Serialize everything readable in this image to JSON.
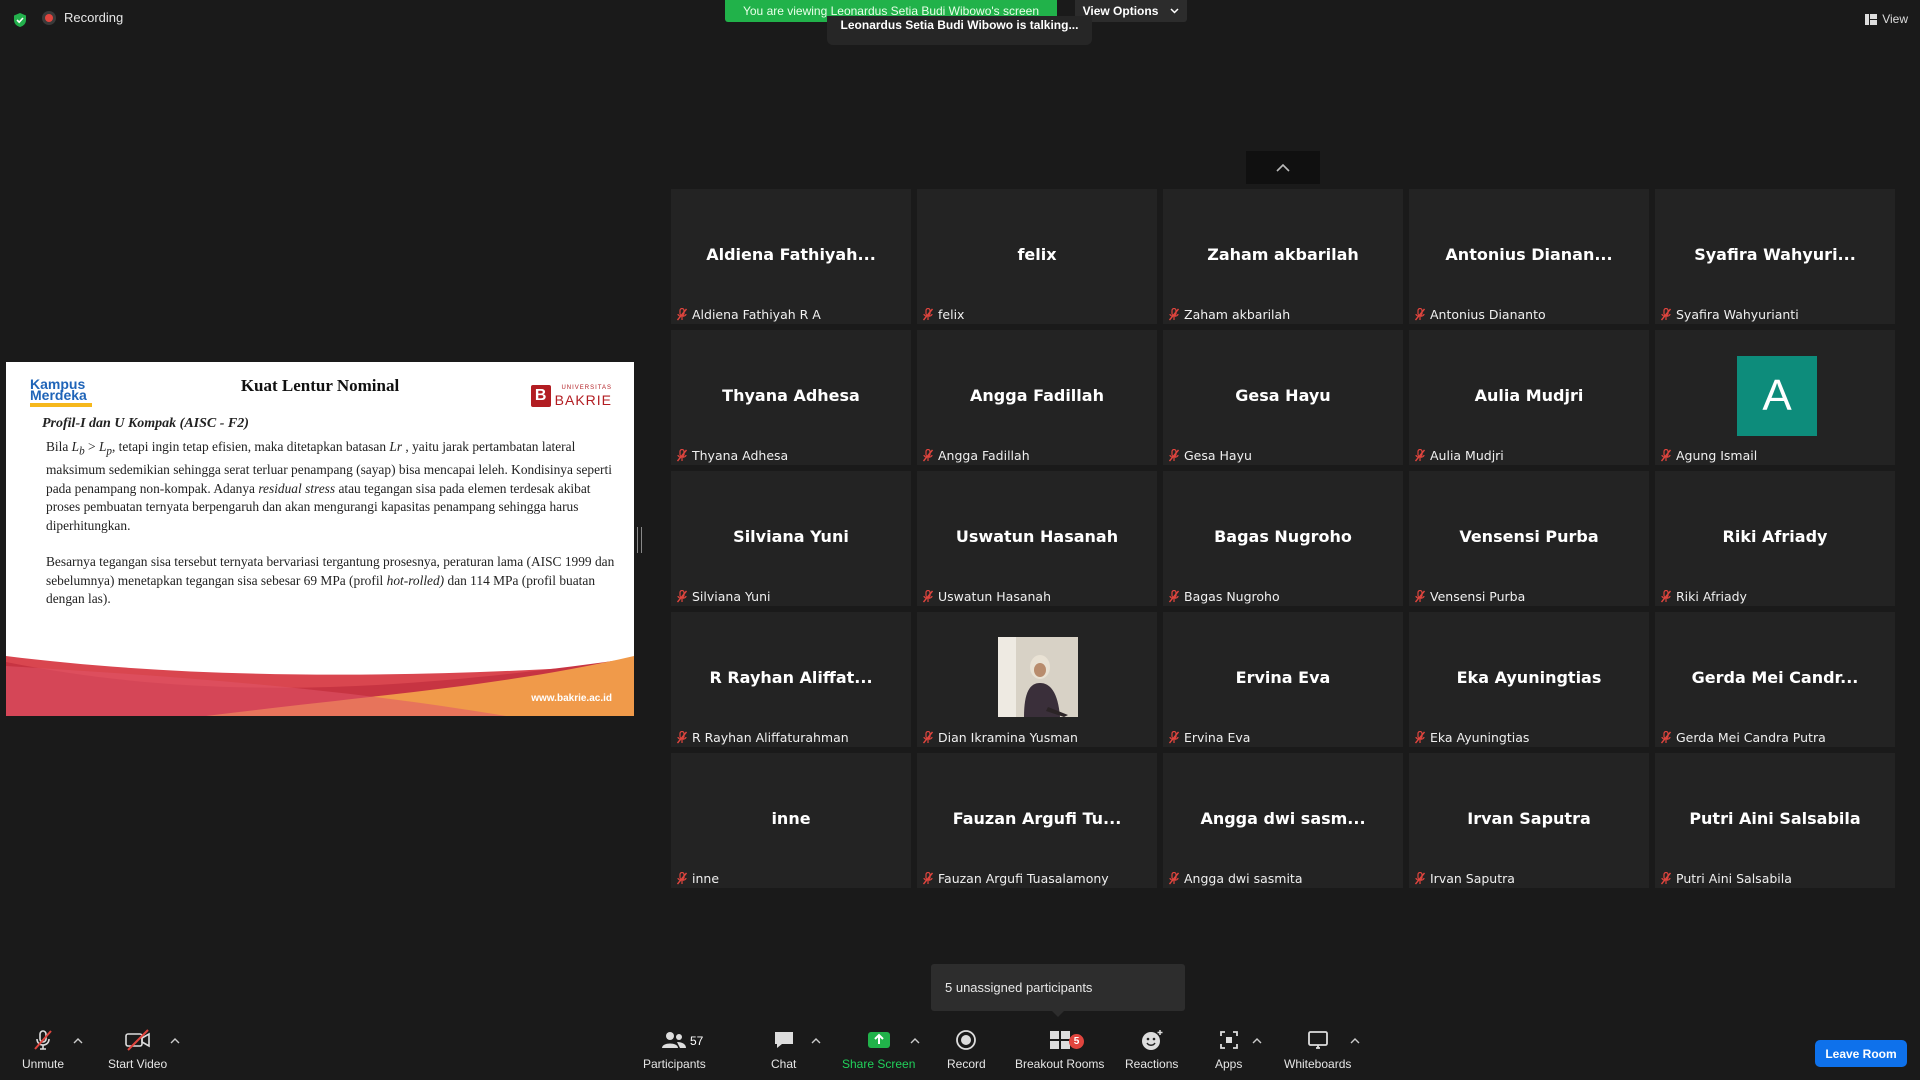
{
  "top": {
    "recording_label": "Recording",
    "viewing_banner": "You are viewing Leonardus Setia Budi Wibowo's screen",
    "view_options_label": "View Options",
    "talking_label": "Leonardus Setia Budi Wibowo is talking...",
    "view_label": "View"
  },
  "slide": {
    "title": "Kuat Lentur Nominal",
    "logo_left_line1": "Kampus",
    "logo_left_line2": "Merdeka",
    "logo_right_small": "UNIVERSITAS",
    "logo_right_name": "BAKRIE",
    "subtitle": "Profil-I dan U Kompak (AISC - F2)",
    "p1_a": "Bila ",
    "p1_lb": "L",
    "p1_lb_sub": "b",
    "p1_gt": " > ",
    "p1_lp": "L",
    "p1_lp_sub": "p",
    "p1_b": ", tetapi ingin tetap efisien, maka ditetapkan batasan ",
    "p1_lr": "Lr",
    "p1_c": " , yaitu jarak pertambatan lateral maksimum sedemikian sehingga serat terluar penampang (sayap) bisa mencapai leleh. Kondisinya seperti pada penampang non-kompak. Adanya ",
    "p1_res": "residual stress",
    "p1_d": " atau tegangan sisa pada elemen terdesak akibat proses pembuatan ternyata berpengaruh dan akan mengurangi kapasitas penampang sehingga harus diperhitungkan.",
    "p2_a": "Besarnya tegangan sisa tersebut ternyata bervariasi tergantung prosesnya, peraturan lama (AISC 1999 dan sebelumnya) menetapkan tegangan sisa sebesar 69 MPa (profil ",
    "p2_hot": "hot-rolled)",
    "p2_b": " dan 114 MPa (profil buatan dengan las).",
    "website": "www.bakrie.ac.id"
  },
  "participants": [
    {
      "display": "Aldiena  Fathiyah...",
      "label": "Aldiena Fathiyah R A"
    },
    {
      "display": "felix",
      "label": "felix"
    },
    {
      "display": "Zaham akbarilah",
      "label": "Zaham akbarilah"
    },
    {
      "display": "Antonius  Dianan...",
      "label": "Antonius Diananto"
    },
    {
      "display": "Syafira  Wahyuri...",
      "label": "Syafira Wahyurianti"
    },
    {
      "display": "Thyana Adhesa",
      "label": "Thyana Adhesa"
    },
    {
      "display": "Angga Fadillah",
      "label": "Angga Fadillah"
    },
    {
      "display": "Gesa Hayu",
      "label": "Gesa Hayu"
    },
    {
      "display": "Aulia Mudjri",
      "label": "Aulia Mudjri"
    },
    {
      "display": "",
      "avatar": "A",
      "label": "Agung Ismail"
    },
    {
      "display": "Silviana Yuni",
      "label": "Silviana Yuni"
    },
    {
      "display": "Uswatun Hasanah",
      "label": "Uswatun Hasanah"
    },
    {
      "display": "Bagas Nugroho",
      "label": "Bagas Nugroho"
    },
    {
      "display": "Vensensi Purba",
      "label": "Vensensi Purba"
    },
    {
      "display": "Riki Afriady",
      "label": "Riki Afriady"
    },
    {
      "display": "R  Rayhan  Aliffat...",
      "label": "R Rayhan Aliffaturahman"
    },
    {
      "display": "",
      "photo": true,
      "label": "Dian Ikramina Yusman"
    },
    {
      "display": "Ervina Eva",
      "label": "Ervina Eva"
    },
    {
      "display": "Eka Ayuningtias",
      "label": "Eka Ayuningtias"
    },
    {
      "display": "Gerda Mei Candr...",
      "label": "Gerda Mei Candra Putra"
    },
    {
      "display": "inne",
      "label": "inne"
    },
    {
      "display": "Fauzan  Argufi  Tu...",
      "label": "Fauzan Argufi Tuasalamony"
    },
    {
      "display": "Angga  dwi sasm...",
      "label": "Angga dwi sasmita"
    },
    {
      "display": "Irvan Saputra",
      "label": "Irvan Saputra"
    },
    {
      "display": "Putri Aini Salsabila",
      "label": "Putri Aini Salsabila"
    }
  ],
  "tooltip": {
    "unassigned": "5 unassigned participants"
  },
  "toolbar": {
    "unmute": "Unmute",
    "start_video": "Start Video",
    "participants": "Participants",
    "participants_count": "57",
    "chat": "Chat",
    "share_screen": "Share Screen",
    "record": "Record",
    "breakout_rooms": "Breakout Rooms",
    "breakout_badge": "5",
    "reactions": "Reactions",
    "apps": "Apps",
    "whiteboards": "Whiteboards",
    "leave_room": "Leave Room"
  },
  "colors": {
    "background": "#1a1a1a",
    "tile": "#232323",
    "banner_green": "#21b24a",
    "leave_blue": "#0e71eb",
    "muted_red": "#e0453e",
    "avatar_teal": "#0d8c7b"
  }
}
